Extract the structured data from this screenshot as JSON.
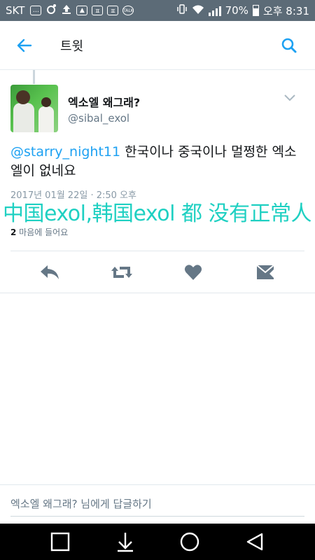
{
  "status_bar": {
    "carrier": "SKT",
    "battery": "70%",
    "time": "오후 8:31",
    "battery_level": 0.7
  },
  "app_bar": {
    "title": "트윗"
  },
  "tweet": {
    "display_name": "엑소엘 왜그래?",
    "handle": "@sibal_exol",
    "mention": "@starry_night11",
    "text": " 한국이나 중국이나 멀쩡한 엑소엘이 없네요",
    "timestamp": "2017년 01월 22일 · 2:50 오후",
    "likes_count": "2",
    "likes_label": " 마음에 들어요"
  },
  "overlay_caption": "中国exol,韩国exol 都 没有正常人",
  "reply": {
    "placeholder": "엑소엘 왜그래? 님에게 답글하기"
  },
  "colors": {
    "accent": "#1da1f2",
    "status_bar": "#5c6b77",
    "caption": "#1fd0c2",
    "icon_gray": "#657786"
  },
  "icons": {
    "back": "arrow-left-icon",
    "search": "search-icon",
    "reply": "reply-icon",
    "retweet": "retweet-icon",
    "like": "heart-icon",
    "dm": "envelope-icon"
  }
}
